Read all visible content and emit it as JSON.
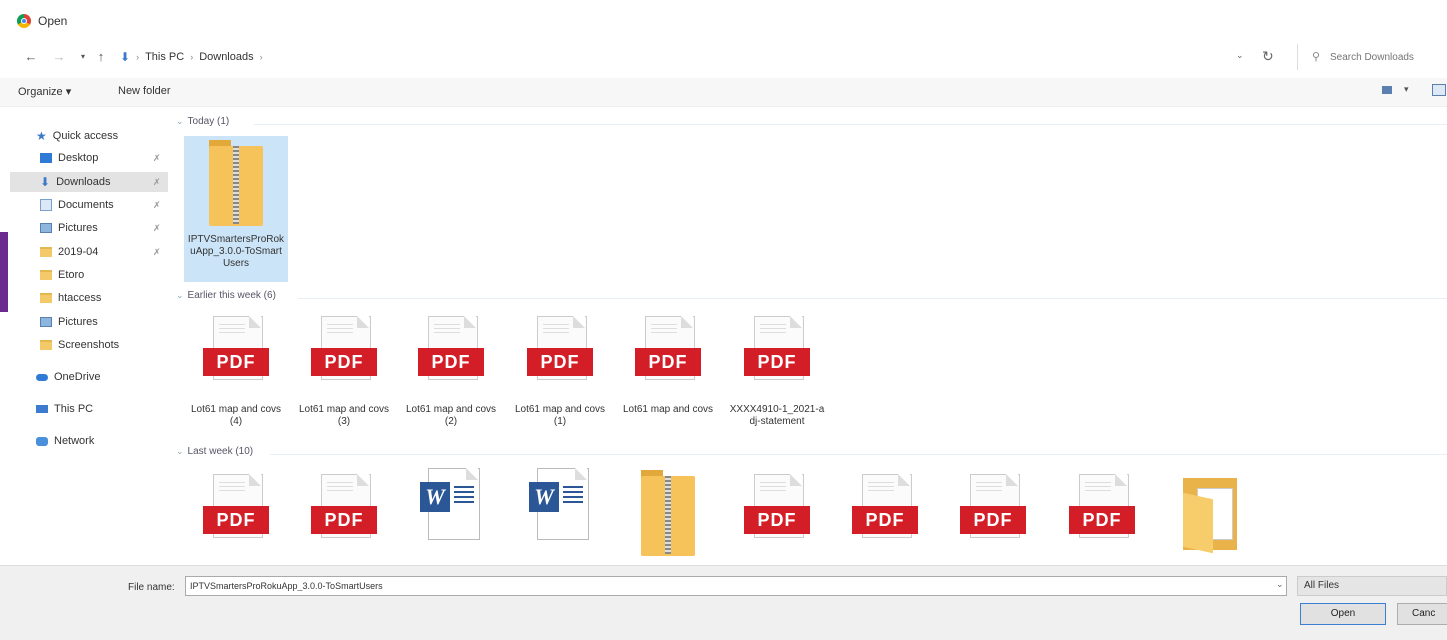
{
  "window": {
    "title": "Open"
  },
  "address": {
    "crumbs": [
      "This PC",
      "Downloads"
    ],
    "search_placeholder": "Search Downloads"
  },
  "toolbar": {
    "organize": "Organize ▾",
    "new_folder": "New folder"
  },
  "nav": {
    "quick_access": "Quick access",
    "items": [
      {
        "label": "Desktop",
        "pinned": true
      },
      {
        "label": "Downloads",
        "pinned": true,
        "selected": true
      },
      {
        "label": "Documents",
        "pinned": true
      },
      {
        "label": "Pictures",
        "pinned": true
      },
      {
        "label": "2019-04",
        "pinned": true
      },
      {
        "label": "Etoro",
        "pinned": false
      },
      {
        "label": "htaccess",
        "pinned": false
      },
      {
        "label": "Pictures",
        "pinned": false
      },
      {
        "label": "Screenshots",
        "pinned": false
      }
    ],
    "onedrive": "OneDrive",
    "this_pc": "This PC",
    "network": "Network"
  },
  "groups": {
    "today": "Today (1)",
    "earlier": "Earlier this week (6)",
    "last_week": "Last week (10)"
  },
  "files": {
    "today": [
      {
        "label": "IPTVSmartersProRokuApp_3.0.0-ToSmartUsers",
        "type": "zip"
      }
    ],
    "earlier": [
      {
        "label": "Lot61 map and covs (4)",
        "type": "pdf"
      },
      {
        "label": "Lot61 map and covs (3)",
        "type": "pdf"
      },
      {
        "label": "Lot61 map and covs (2)",
        "type": "pdf"
      },
      {
        "label": "Lot61 map and covs (1)",
        "type": "pdf"
      },
      {
        "label": "Lot61 map and covs",
        "type": "pdf"
      },
      {
        "label": "XXXX4910-1_2021-adj-statement",
        "type": "pdf"
      }
    ],
    "last_week": [
      "pdf",
      "pdf",
      "word",
      "word",
      "zip",
      "pdf",
      "pdf",
      "pdf",
      "pdf",
      "folder"
    ]
  },
  "pdf_text": "PDF",
  "word_text": "W",
  "footer": {
    "file_name_label": "File name:",
    "file_name_value": "IPTVSmartersProRokuApp_3.0.0-ToSmartUsers",
    "filter": "All Files",
    "open": "Open",
    "cancel": "Canc"
  }
}
